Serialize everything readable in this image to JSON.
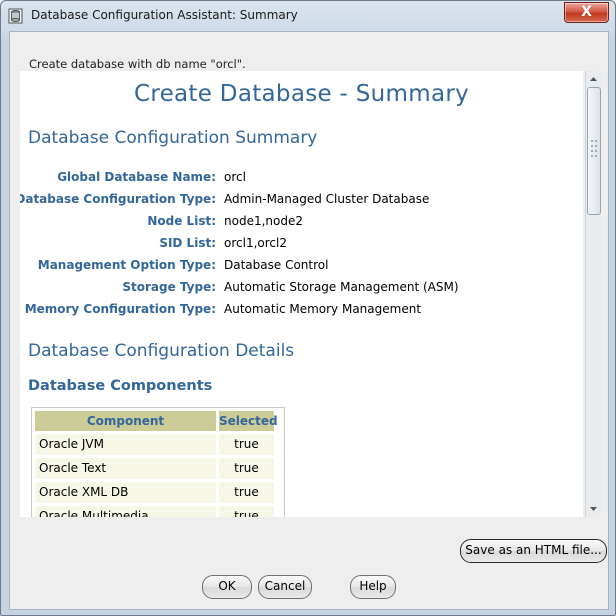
{
  "window": {
    "title": "Database Configuration Assistant: Summary",
    "close_glyph": "X"
  },
  "header_message": "Create database with db name \"orcl\".",
  "summary": {
    "main_heading": "Create Database - Summary",
    "config_summary_heading": "Database Configuration Summary",
    "fields": [
      {
        "label": "Global Database Name:",
        "value": "orcl"
      },
      {
        "label": "Database Configuration Type:",
        "value": "Admin-Managed Cluster Database"
      },
      {
        "label": "Node List:",
        "value": "node1,node2"
      },
      {
        "label": "SID List:",
        "value": "orcl1,orcl2"
      },
      {
        "label": "Management Option Type:",
        "value": "Database Control"
      },
      {
        "label": "Storage Type:",
        "value": "Automatic Storage Management (ASM)"
      },
      {
        "label": "Memory Configuration Type:",
        "value": "Automatic Memory Management"
      }
    ],
    "details_heading": "Database Configuration Details",
    "components_heading": "Database Components",
    "components_table": {
      "headers": [
        "Component",
        "Selected"
      ],
      "rows": [
        [
          "Oracle JVM",
          "true"
        ],
        [
          "Oracle Text",
          "true"
        ],
        [
          "Oracle XML DB",
          "true"
        ],
        [
          "Oracle Multimedia",
          "true"
        ]
      ]
    }
  },
  "buttons": {
    "save_html": "Save as an HTML file...",
    "ok": "OK",
    "cancel": "Cancel",
    "help": "Help"
  },
  "icons": {
    "app": "database-icon",
    "scroll_up": "scroll-up-arrow-icon",
    "scroll_down": "scroll-down-arrow-icon"
  }
}
